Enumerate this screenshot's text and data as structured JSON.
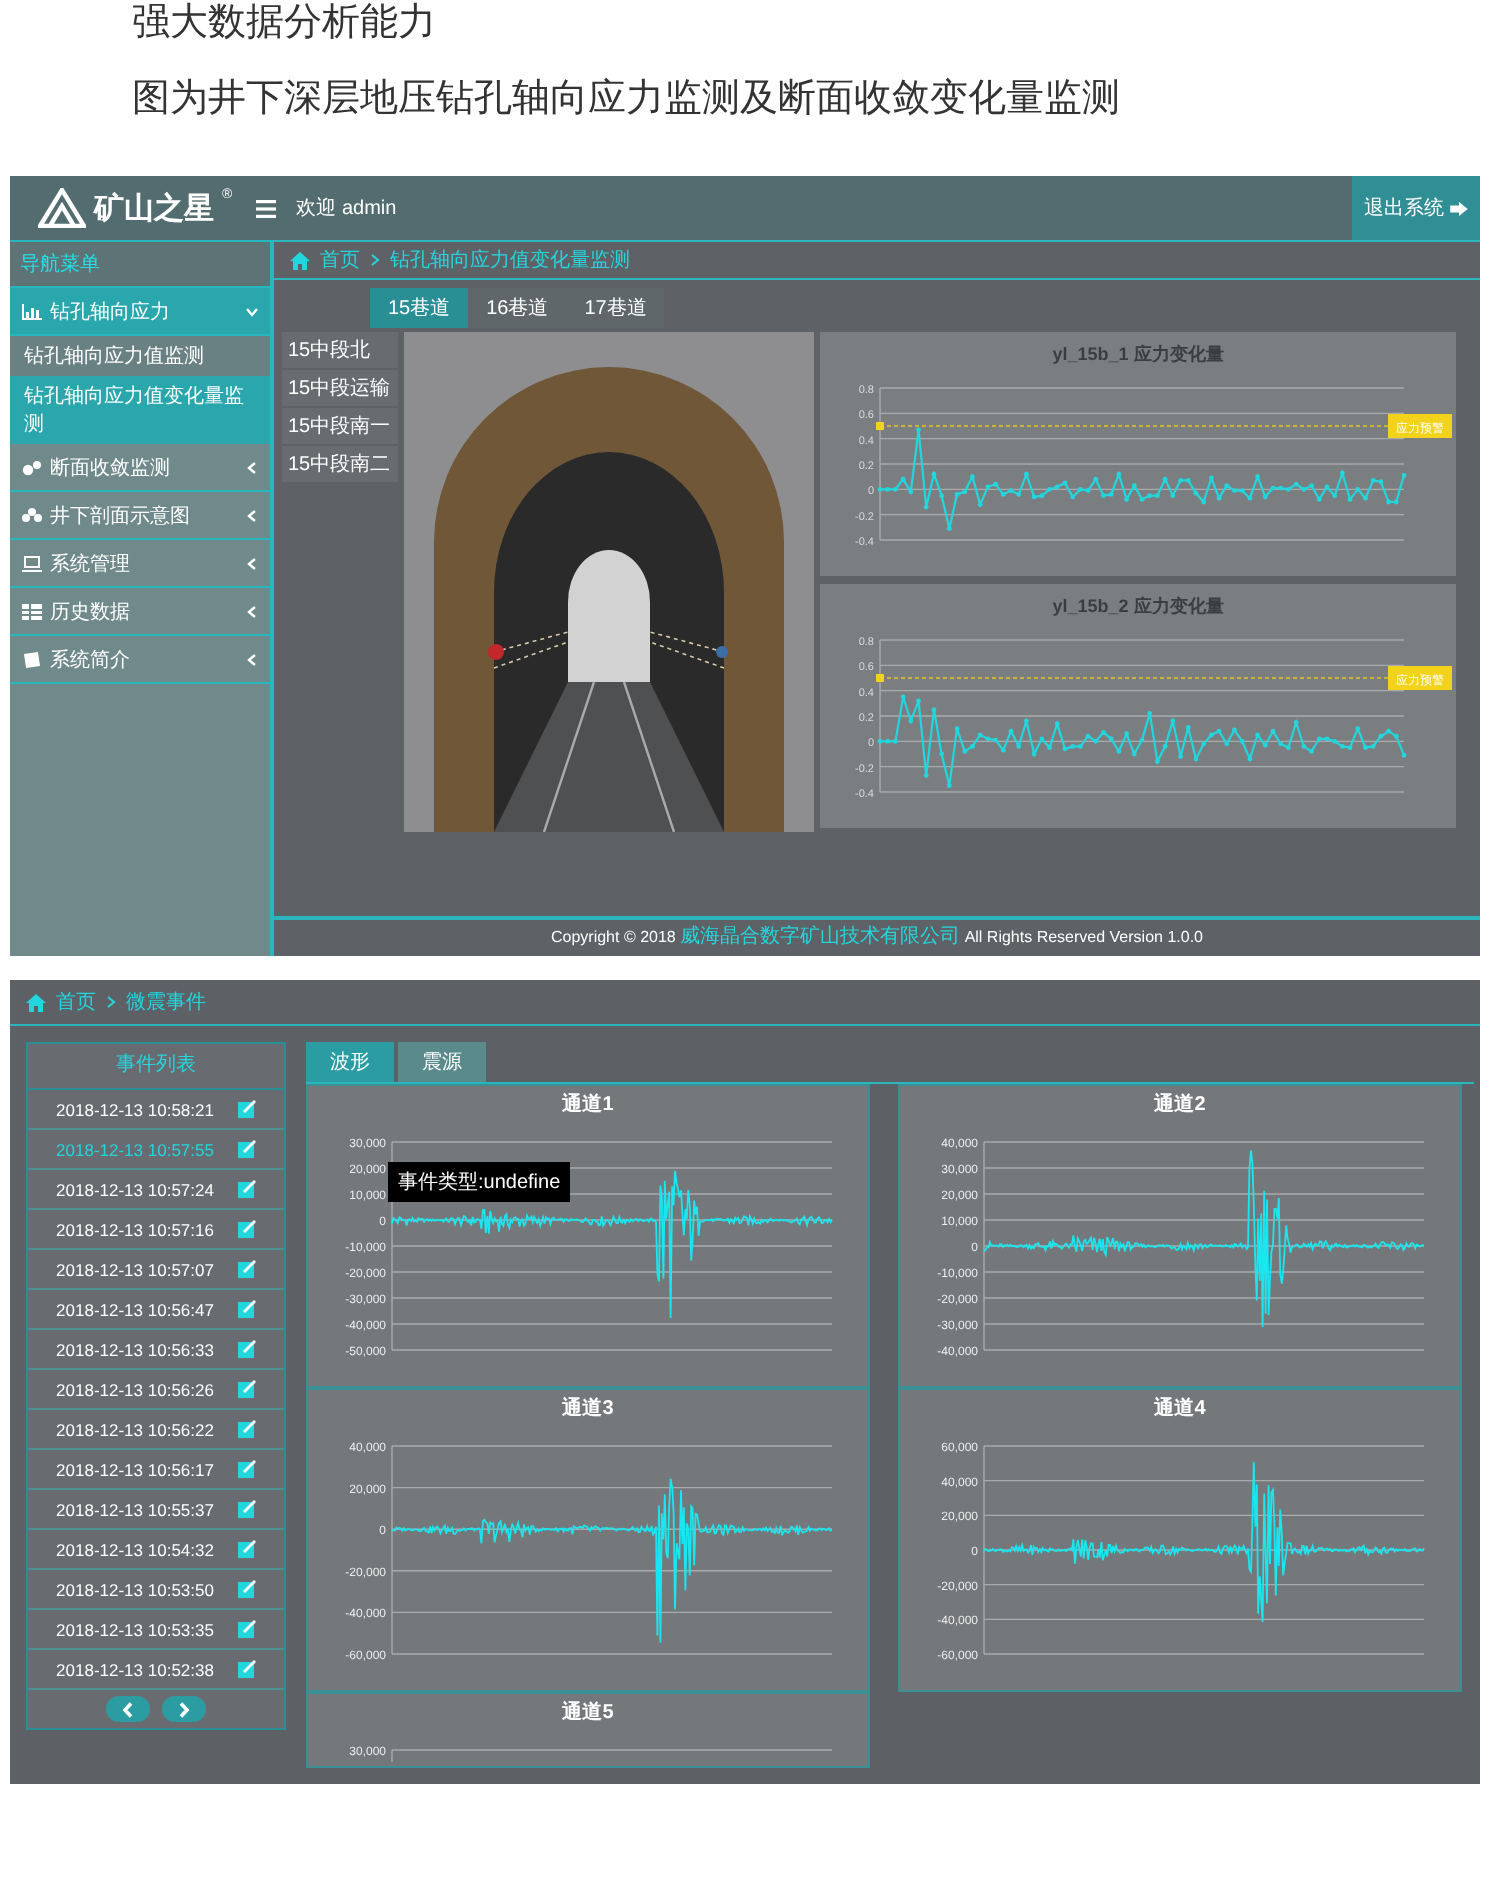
{
  "headings": [
    "强大数据分析能力",
    "图为井下深层地压钻孔轴向应力监测及断面收敛变化量监测"
  ],
  "app": {
    "brand": "矿山之星",
    "registered": "®",
    "welcome": "欢迎 admin",
    "logout": "退出系统",
    "sidebar": {
      "title": "导航菜单",
      "items": [
        {
          "label": "钻孔轴向应力",
          "expanded": true,
          "children": [
            {
              "label": "钻孔轴向应力值监测",
              "selected": false
            },
            {
              "label": "钻孔轴向应力值变化量监测",
              "selected": true
            }
          ]
        },
        {
          "label": "断面收敛监测",
          "expanded": false
        },
        {
          "label": "井下剖面示意图",
          "expanded": false
        },
        {
          "label": "系统管理",
          "expanded": false
        },
        {
          "label": "历史数据",
          "expanded": false
        },
        {
          "label": "系统简介",
          "expanded": false
        }
      ]
    },
    "breadcrumb": [
      "首页",
      "钻孔轴向应力值变化量监测"
    ],
    "tabs": [
      {
        "label": "15巷道",
        "selected": true
      },
      {
        "label": "16巷道",
        "selected": false
      },
      {
        "label": "17巷道",
        "selected": false
      }
    ],
    "locations": [
      "15中段北",
      "15中段运输",
      "15中段南一",
      "15中段南二"
    ],
    "charts": [
      {
        "chart_data": {
          "type": "line",
          "title": "yl_15b_1 应力变化量",
          "ylim": [
            -0.4,
            0.8
          ],
          "yticks": [
            -0.4,
            -0.2,
            0,
            0.2,
            0.4,
            0.6,
            0.8
          ],
          "grid": true,
          "ref_lines": [
            {
              "axis": "y",
              "value": 0.5,
              "label": "应力预警"
            }
          ],
          "series": [
            {
              "color": "#22d6de",
              "values": [
                0,
                0,
                0,
                0.08,
                -0.02,
                0.47,
                -0.14,
                0.12,
                -0.05,
                -0.31,
                -0.04,
                -0.02,
                0.1,
                -0.12,
                0.02,
                0.04,
                -0.04,
                -0.01,
                -0.04,
                0.12,
                -0.06,
                -0.05,
                0,
                0.02,
                0.05,
                -0.06,
                0,
                -0.01,
                0.08,
                -0.05,
                -0.04,
                0.12,
                -0.08,
                0.03,
                -0.08,
                -0.05,
                -0.05,
                0.08,
                -0.05,
                0.07,
                0.07,
                -0.03,
                -0.1,
                0.09,
                -0.07,
                0.03,
                -0.01,
                -0.01,
                -0.07,
                0.1,
                -0.06,
                0.01,
                0.01,
                0,
                0.04,
                0,
                0.03,
                -0.08,
                0.02,
                -0.05,
                0.13,
                -0.08,
                0,
                -0.07,
                0.07,
                0.06,
                -0.1,
                -0.1,
                0.11
              ]
            }
          ]
        }
      },
      {
        "chart_data": {
          "type": "line",
          "title": "yl_15b_2 应力变化量",
          "ylim": [
            -0.4,
            0.8
          ],
          "yticks": [
            -0.4,
            -0.2,
            0,
            0.2,
            0.4,
            0.6,
            0.8
          ],
          "grid": true,
          "ref_lines": [
            {
              "axis": "y",
              "value": 0.5,
              "label": "应力预警"
            }
          ],
          "series": [
            {
              "color": "#22d6de",
              "values": [
                0,
                0,
                0,
                0.35,
                0.16,
                0.32,
                -0.27,
                0.25,
                -0.1,
                -0.35,
                0.1,
                -0.08,
                -0.04,
                0.05,
                0.02,
                0.01,
                -0.07,
                0.08,
                -0.04,
                0.16,
                -0.1,
                0.02,
                -0.05,
                0.14,
                -0.06,
                -0.04,
                -0.04,
                0.04,
                0,
                0.07,
                0.02,
                -0.08,
                0.06,
                -0.1,
                0.01,
                0.22,
                -0.16,
                -0.04,
                0.16,
                -0.12,
                0.11,
                -0.14,
                -0.02,
                0.05,
                0.08,
                -0.02,
                0.09,
                0,
                -0.14,
                0.05,
                -0.03,
                0.08,
                -0.02,
                -0.05,
                0.15,
                -0.04,
                -0.08,
                0.02,
                0.02,
                0,
                -0.04,
                -0.05,
                0.1,
                -0.05,
                -0.04,
                0.04,
                0.08,
                0.04,
                -0.11
              ]
            }
          ]
        }
      }
    ],
    "footer": {
      "before": "Copyright © 2018",
      "company": "威海晶合数字矿山技术有限公司",
      "after": "All Rights Reserved Version 1.0.0"
    }
  },
  "events_app": {
    "breadcrumb": [
      "首页",
      "微震事件"
    ],
    "events": {
      "title": "事件列表",
      "tooltip": "事件类型:undefine",
      "items": [
        {
          "time": "2018-12-13 10:58:21",
          "selected": false
        },
        {
          "time": "2018-12-13 10:57:55",
          "selected": true
        },
        {
          "time": "2018-12-13 10:57:24",
          "selected": false
        },
        {
          "time": "2018-12-13 10:57:16",
          "selected": false
        },
        {
          "time": "2018-12-13 10:57:07",
          "selected": false
        },
        {
          "time": "2018-12-13 10:56:47",
          "selected": false
        },
        {
          "time": "2018-12-13 10:56:33",
          "selected": false
        },
        {
          "time": "2018-12-13 10:56:26",
          "selected": false
        },
        {
          "time": "2018-12-13 10:56:22",
          "selected": false
        },
        {
          "time": "2018-12-13 10:56:17",
          "selected": false
        },
        {
          "time": "2018-12-13 10:55:37",
          "selected": false
        },
        {
          "time": "2018-12-13 10:54:32",
          "selected": false
        },
        {
          "time": "2018-12-13 10:53:50",
          "selected": false
        },
        {
          "time": "2018-12-13 10:53:35",
          "selected": false
        },
        {
          "time": "2018-12-13 10:52:38",
          "selected": false
        }
      ]
    },
    "tabs": [
      {
        "label": "波形",
        "selected": true
      },
      {
        "label": "震源",
        "selected": false
      }
    ],
    "channels": [
      {
        "title": "通道1",
        "yticks": [
          "30,000",
          "20,000",
          "10,000",
          "0",
          "-10,000",
          "-20,000",
          "-30,000",
          "-40,000",
          "-50,000"
        ]
      },
      {
        "title": "通道2",
        "yticks": [
          "40,000",
          "30,000",
          "20,000",
          "10,000",
          "0",
          "-10,000",
          "-20,000",
          "-30,000",
          "-40,000"
        ]
      },
      {
        "title": "通道3",
        "yticks": [
          "40,000",
          "20,000",
          "0",
          "-20,000",
          "-40,000",
          "-60,000"
        ]
      },
      {
        "title": "通道4",
        "yticks": [
          "60,000",
          "40,000",
          "20,000",
          "0",
          "-20,000",
          "-40,000",
          "-60,000"
        ]
      }
    ],
    "partial_channel": {
      "title": "通道5",
      "yticks": [
        "30,000"
      ]
    }
  }
}
